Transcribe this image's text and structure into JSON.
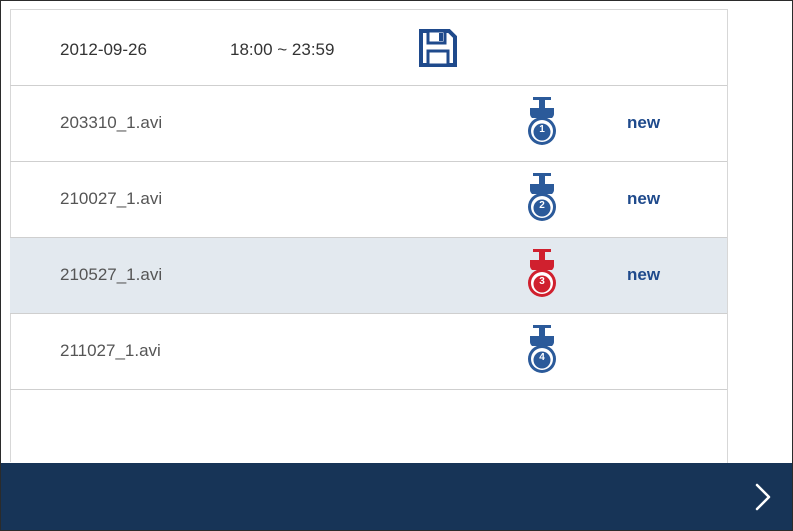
{
  "header": {
    "date": "2012-09-26",
    "time_range": "18:00 ~ 23:59",
    "save_icon": "floppy-disk-icon"
  },
  "files": [
    {
      "name": "203310_1.avi",
      "camera": "1",
      "camera_color": "#2b5a9a",
      "badge": "new",
      "selected": false
    },
    {
      "name": "210027_1.avi",
      "camera": "2",
      "camera_color": "#2b5a9a",
      "badge": "new",
      "selected": false
    },
    {
      "name": "210527_1.avi",
      "camera": "3",
      "camera_color": "#d0202e",
      "badge": "new",
      "selected": true
    },
    {
      "name": "211027_1.avi",
      "camera": "4",
      "camera_color": "#2b5a9a",
      "badge": "",
      "selected": false
    }
  ],
  "footer": {
    "next_icon": "chevron-right-icon",
    "background": "#173457"
  },
  "colors": {
    "accent_blue": "#1f4a8c",
    "highlight_red": "#d0202e",
    "selected_row_bg": "#e3e9ef"
  }
}
